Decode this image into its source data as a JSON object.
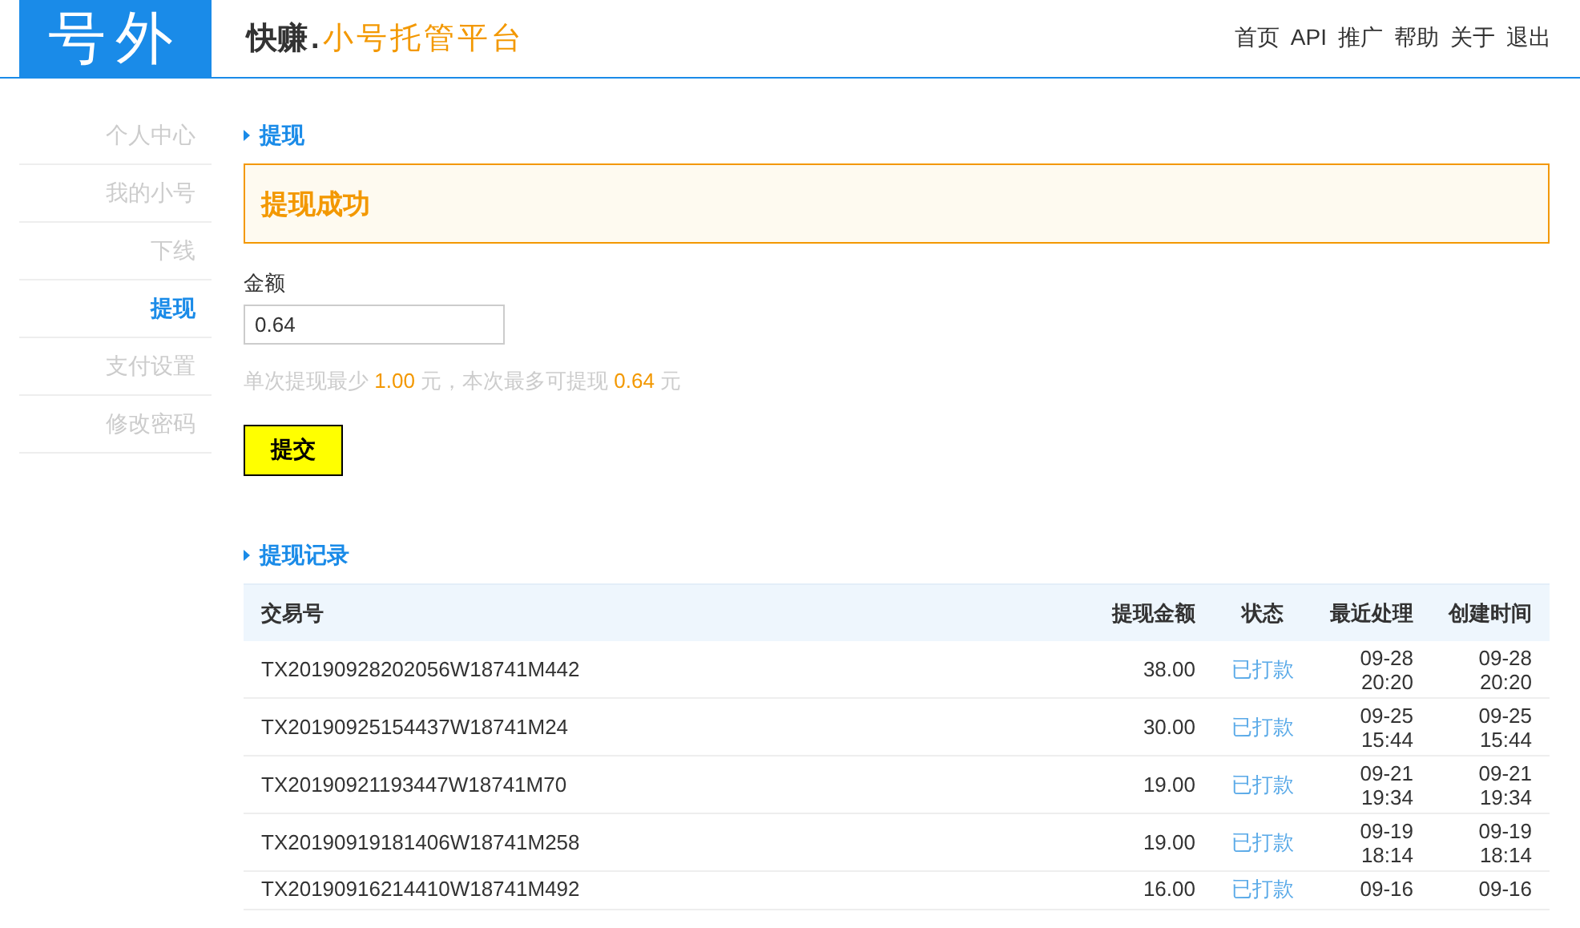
{
  "header": {
    "logo": "号外",
    "brand_main": "快赚",
    "brand_dot": ".",
    "brand_sub": "小号托管平台",
    "nav": [
      "首页",
      "API",
      "推广",
      "帮助",
      "关于",
      "退出"
    ]
  },
  "sidebar": {
    "items": [
      {
        "label": "个人中心",
        "selected": false
      },
      {
        "label": "我的小号",
        "selected": false
      },
      {
        "label": "下线",
        "selected": false
      },
      {
        "label": "提现",
        "selected": true
      },
      {
        "label": "支付设置",
        "selected": false
      },
      {
        "label": "修改密码",
        "selected": false
      }
    ]
  },
  "withdraw": {
    "title": "提现",
    "alert": "提现成功",
    "amount_label": "金额",
    "amount_value": "0.64",
    "hint": "单次提现最少 **1.00** 元，本次最多可提现 **0.64** 元",
    "submit": "提交"
  },
  "records": {
    "title": "提现记录",
    "columns": [
      "交易号",
      "提现金额",
      "状态",
      "最近处理",
      "创建时间"
    ],
    "rows": [
      [
        "TX20190928202056W18741M442",
        "38.00",
        "已打款",
        "09-28 20:20",
        "09-28 20:20"
      ],
      [
        "TX20190925154437W18741M24",
        "30.00",
        "已打款",
        "09-25 15:44",
        "09-25 15:44"
      ],
      [
        "TX20190921193447W18741M70",
        "19.00",
        "已打款",
        "09-21 19:34",
        "09-21 19:34"
      ],
      [
        "TX20190919181406W18741M258",
        "19.00",
        "已打款",
        "09-19 18:14",
        "09-19 18:14"
      ],
      [
        "TX20190916214410W18741M492",
        "16.00",
        "已打款",
        "09-16",
        "09-16"
      ]
    ]
  }
}
